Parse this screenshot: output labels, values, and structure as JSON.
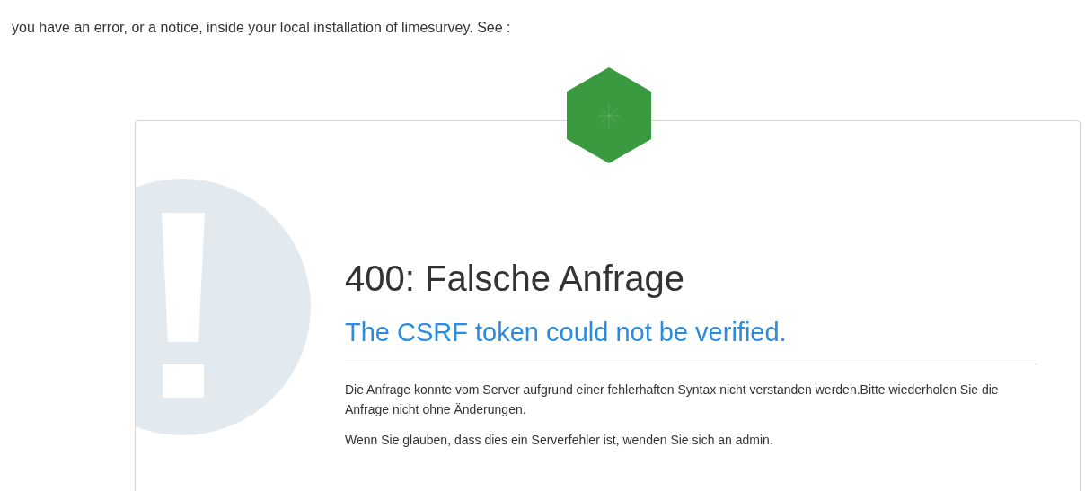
{
  "notice": "you have an error, or a notice, inside your local installation of limesurvey. See :",
  "error": {
    "title": "400: Falsche Anfrage",
    "subtitle": "The CSRF token could not be verified.",
    "paragraphs": [
      "Die Anfrage konnte vom Server aufgrund einer fehlerhaften Syntax nicht verstanden werden.Bitte wiederholen Sie die Anfrage nicht ohne Änderungen.",
      "Wenn Sie glauben, dass dies ein Serverfehler ist, wenden Sie sich an admin."
    ]
  }
}
